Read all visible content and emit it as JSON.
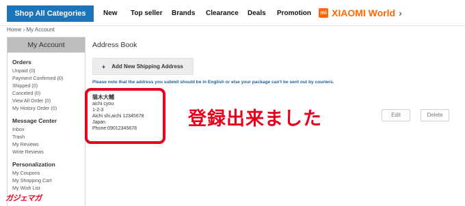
{
  "topnav": {
    "category_button": "Shop All Categories",
    "items": [
      "New",
      "Top seller",
      "Brands",
      "Clearance",
      "Deals",
      "Promotion"
    ],
    "promo_mark": "mi",
    "promo_text": "XIAOMI World",
    "promo_chevron": "›"
  },
  "breadcrumb": "Home › My Account",
  "sidebar": {
    "header": "My Account",
    "sections": [
      {
        "title": "Orders",
        "links": [
          "Unpaid (0)",
          "Payment Confirmed (0)",
          "Shipped (0)",
          "Canceled (0)",
          "View All Order (0)",
          "My History Order (0)"
        ]
      },
      {
        "title": "Message Center",
        "links": [
          "Inbox",
          "Trash",
          "My Reviews",
          "Write Reviews"
        ]
      },
      {
        "title": "Personalization",
        "links": [
          "My Coupons",
          "My Shopping Cart",
          "My Wish List"
        ]
      }
    ]
  },
  "main": {
    "title": "Address Book",
    "add_button": "Add New Shipping Address",
    "add_icon": "+",
    "note": "Please note that the address you submit should be in English or else your package can't be sent out by couriers.",
    "address": {
      "name": "猫木大輔",
      "lines": [
        "aichi cyou",
        "1-2-3",
        "Aichi shi,aichi 12345678",
        "Japan",
        "Phone:09012345678"
      ]
    },
    "edit_button": "Edit",
    "delete_button": "Delete"
  },
  "annotation": "登録出来ました",
  "watermark": "ガジェマガ",
  "colors": {
    "accent_blue": "#1d74b8",
    "promo_orange": "#ff6700",
    "highlight_red": "#e6001e",
    "note_blue": "#1d5f99"
  }
}
